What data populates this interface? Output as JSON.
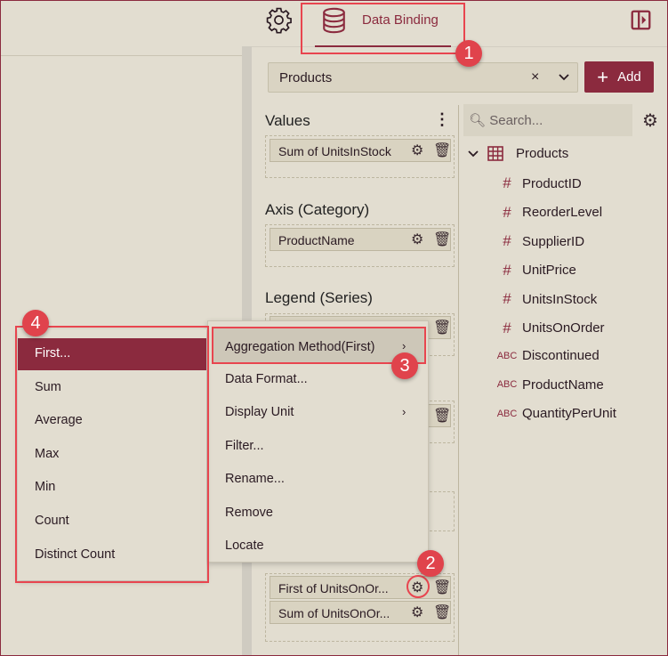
{
  "header": {
    "tab_label": "Data Binding",
    "settings_icon": "gear-icon",
    "tab_icon": "database-icon",
    "collapse_icon": "panel-collapse-icon"
  },
  "dataset": {
    "value": "Products",
    "add_label": "Add"
  },
  "sections": [
    {
      "title": "Values",
      "items": [
        "Sum of UnitsInStock"
      ]
    },
    {
      "title": "Axis (Category)",
      "items": [
        "ProductName"
      ]
    },
    {
      "title": "Legend (Series)",
      "items": []
    },
    {
      "title": "",
      "items": []
    },
    {
      "title": "",
      "items": []
    },
    {
      "title": "",
      "items": [
        "First of UnitsOnOr...",
        "Sum of UnitsOnOr..."
      ]
    }
  ],
  "fields": {
    "search_placeholder": "Search...",
    "table": "Products",
    "items": [
      {
        "type": "#",
        "name": "ProductID"
      },
      {
        "type": "#",
        "name": "ReorderLevel"
      },
      {
        "type": "#",
        "name": "SupplierID"
      },
      {
        "type": "#",
        "name": "UnitPrice"
      },
      {
        "type": "#",
        "name": "UnitsInStock"
      },
      {
        "type": "#",
        "name": "UnitsOnOrder"
      },
      {
        "type": "ABC",
        "name": "Discontinued"
      },
      {
        "type": "ABC",
        "name": "ProductName"
      },
      {
        "type": "ABC",
        "name": "QuantityPerUnit"
      }
    ]
  },
  "context_menu": [
    "Aggregation Method(First)",
    "Data Format...",
    "Display Unit",
    "Filter...",
    "Rename...",
    "Remove",
    "Locate"
  ],
  "submenu": [
    "First...",
    "Sum",
    "Average",
    "Max",
    "Min",
    "Count",
    "Distinct Count"
  ],
  "badges": [
    "1",
    "2",
    "3",
    "4"
  ],
  "colors": {
    "accent": "#8b2a3e",
    "background": "#e2ddd0",
    "callout": "#e0434c"
  }
}
